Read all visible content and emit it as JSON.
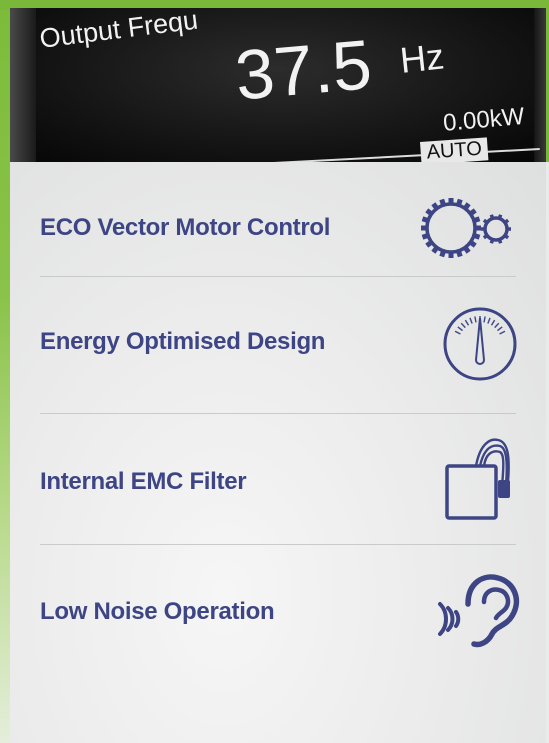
{
  "display": {
    "label": "Output Frequ",
    "value": "37.5",
    "unit": "Hz",
    "power": "0.00kW",
    "mode": "AUTO"
  },
  "colors": {
    "accent_green": "#7ab83a",
    "text_blue": "#3d4585"
  },
  "features": [
    {
      "label": "ECO Vector Motor Control",
      "icon": "gears-icon"
    },
    {
      "label": "Energy Optimised Design",
      "icon": "gauge-icon"
    },
    {
      "label": "Internal EMC Filter",
      "icon": "filter-cable-icon"
    },
    {
      "label": "Low Noise Operation",
      "icon": "ear-sound-icon"
    }
  ]
}
